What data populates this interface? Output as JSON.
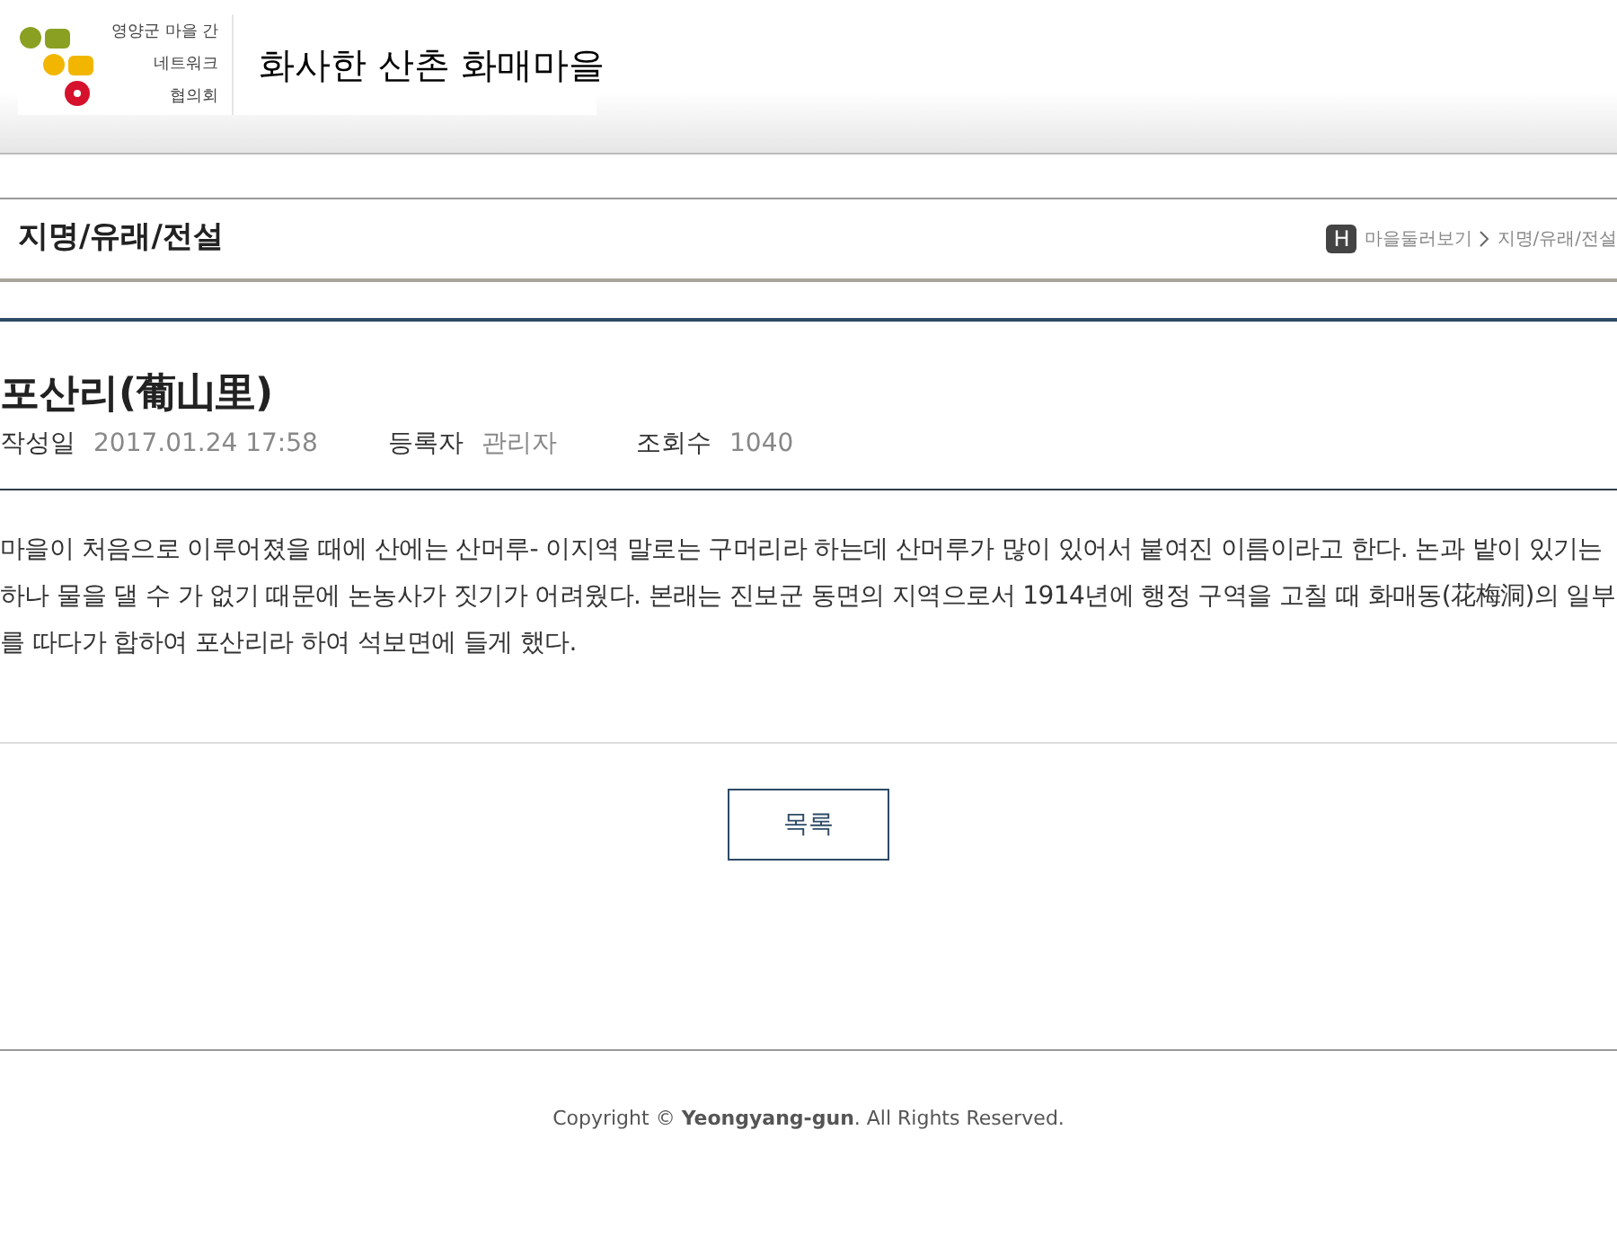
{
  "header": {
    "logo_lines": [
      "영양군 마을 간",
      "네트워크",
      "협의회"
    ],
    "site_title": "화사한 산촌 화매마을"
  },
  "page_heading": {
    "title": "지명/유래/전설",
    "home_badge": "H",
    "breadcrumb": [
      "마을둘러보기",
      "지명/유래/전설"
    ]
  },
  "post": {
    "title": "포산리(葡山里)",
    "meta": [
      {
        "label": "작성일",
        "value": "2017.01.24 17:58"
      },
      {
        "label": "등록자",
        "value": "관리자"
      },
      {
        "label": "조회수",
        "value": "1040"
      }
    ],
    "body": "마을이 처음으로 이루어졌을 때에 산에는 산머루- 이지역 말로는 구머리라 하는데 산머루가 많이 있어서 붙여진 이름이라고 한다. 논과 밭이 있기는 하나 물을 댈 수 가 없기 때문에 논농사가 짓기가 어려웠다. 본래는 진보군 동면의 지역으로서 1914년에 행정 구역을 고칠 때 화매동(花梅洞)의 일부를 따다가 합하여 포산리라 하여 석보면에 들게 했다."
  },
  "list_button": "목록",
  "footer": "Copyright © **Yeongyang-gun**. All Rights Reserved."
}
